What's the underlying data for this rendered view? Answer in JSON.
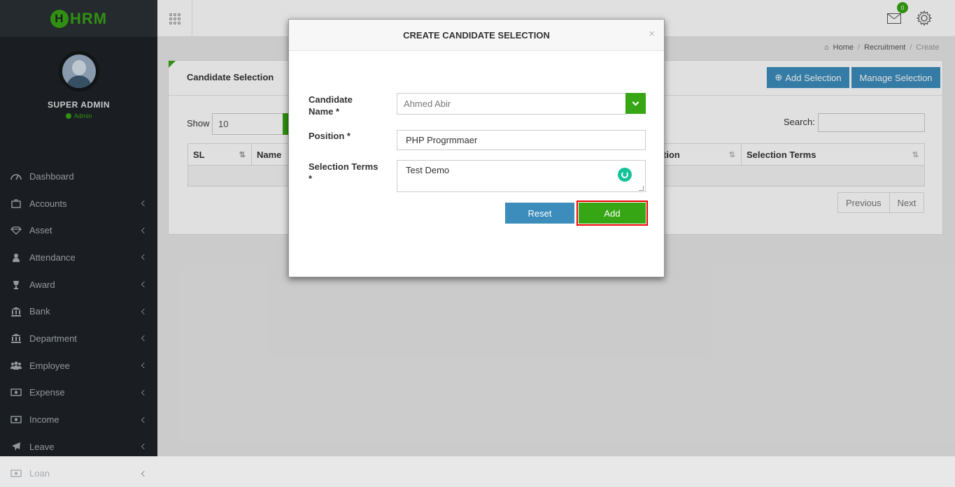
{
  "app": {
    "logo_text": "HRM",
    "logo_letter": "H"
  },
  "profile": {
    "name": "SUPER ADMIN",
    "role": "Admin"
  },
  "sidebar": {
    "items": [
      {
        "label": "Dashboard",
        "icon": "dashboard-icon",
        "has_submenu": false
      },
      {
        "label": "Accounts",
        "icon": "briefcase-icon",
        "has_submenu": true
      },
      {
        "label": "Asset",
        "icon": "diamond-icon",
        "has_submenu": true
      },
      {
        "label": "Attendance",
        "icon": "user-icon",
        "has_submenu": true
      },
      {
        "label": "Award",
        "icon": "trophy-icon",
        "has_submenu": true
      },
      {
        "label": "Bank",
        "icon": "bank-icon",
        "has_submenu": true
      },
      {
        "label": "Department",
        "icon": "bank-icon",
        "has_submenu": true
      },
      {
        "label": "Employee",
        "icon": "users-icon",
        "has_submenu": true
      },
      {
        "label": "Expense",
        "icon": "money-icon",
        "has_submenu": true
      },
      {
        "label": "Income",
        "icon": "money-icon",
        "has_submenu": true
      },
      {
        "label": "Leave",
        "icon": "plane-icon",
        "has_submenu": true
      },
      {
        "label": "Loan",
        "icon": "money-icon",
        "has_submenu": true
      }
    ]
  },
  "topbar": {
    "mail_count": "0"
  },
  "breadcrumb": {
    "home": "Home",
    "section": "Recruitment",
    "current": "Create"
  },
  "panel": {
    "title": "Candidate Selection",
    "add_button": "Add Selection",
    "manage_button": "Manage Selection",
    "show_label": "Show",
    "show_value": "10",
    "search_label": "Search:",
    "columns": [
      "SL",
      "Name",
      "tion",
      "Selection Terms"
    ],
    "pager": {
      "previous": "Previous",
      "next": "Next"
    }
  },
  "modal": {
    "title": "CREATE CANDIDATE SELECTION",
    "close": "×",
    "candidate_label_1": "Candidate",
    "candidate_label_2": "Name *",
    "candidate_value": "Ahmed Abir",
    "position_label": "Position *",
    "position_value": "PHP Progrmmaer",
    "terms_label_1": "Selection Terms",
    "terms_label_2": "*",
    "terms_value": "Test Demo",
    "reset_button": "Reset",
    "add_button": "Add"
  },
  "colors": {
    "accent_green": "#37a614",
    "primary_blue": "#3c8dbc",
    "sidebar_bg": "#1e2328",
    "highlight_red": "#ee0000"
  }
}
